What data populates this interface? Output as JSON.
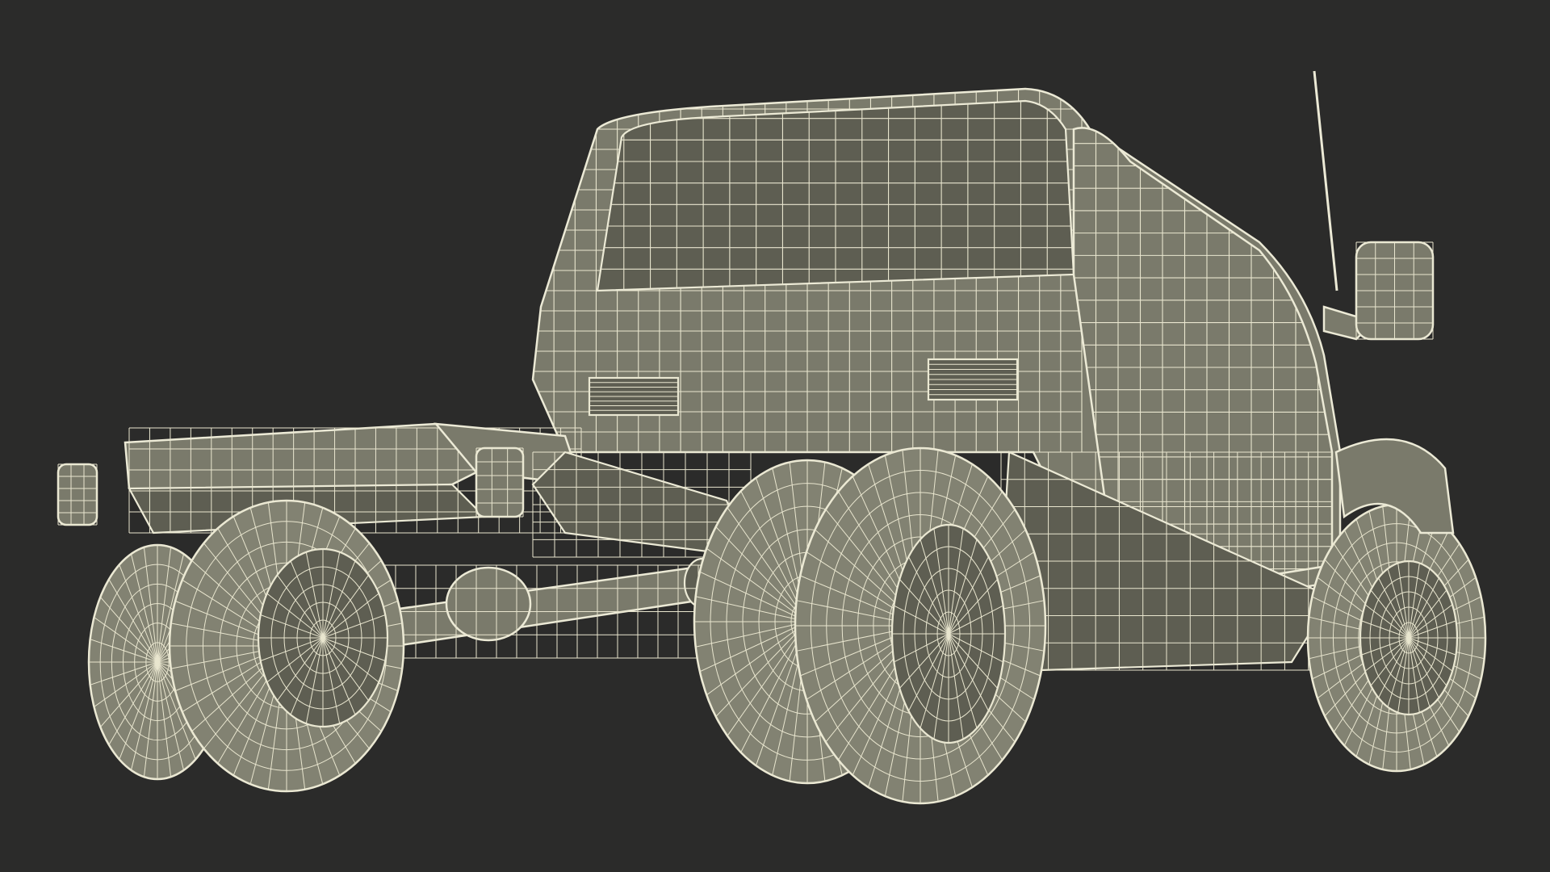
{
  "scene": {
    "background_color": "#2b2b2a",
    "model_surface_color": "#7a7a6b",
    "wire_color": "#e9e6cf",
    "subject_icon": "wireframe-truck-chassis-icon"
  }
}
